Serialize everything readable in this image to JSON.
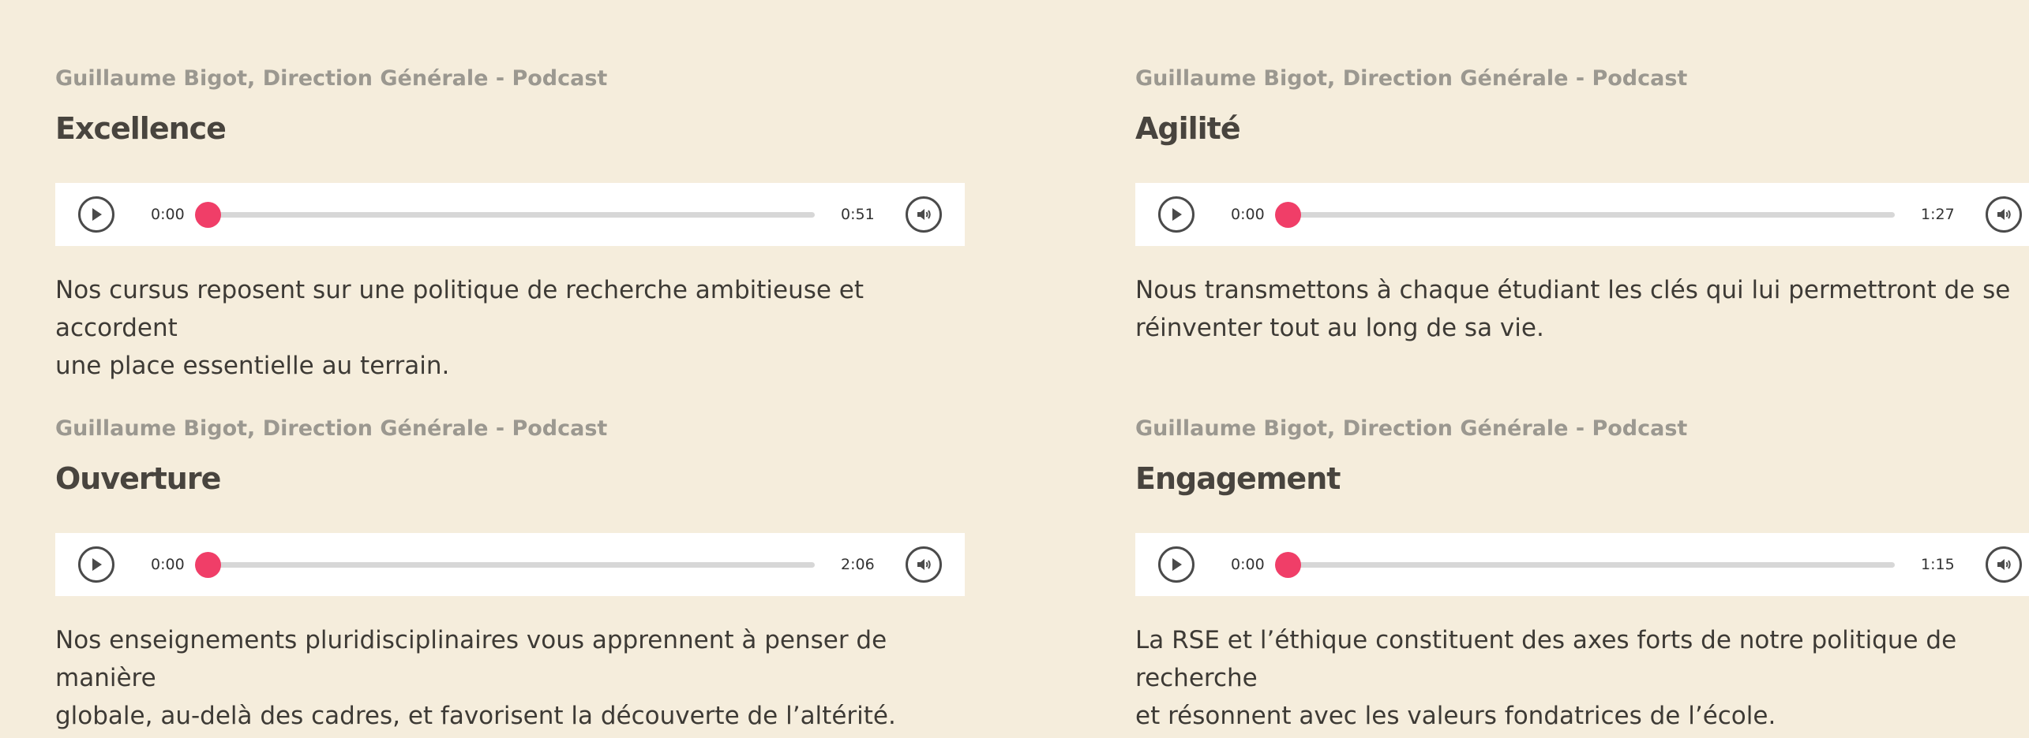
{
  "podcasts": [
    {
      "author": "Guillaume Bigot, Direction Générale - Podcast",
      "title": "Excellence",
      "current_time": "0:00",
      "duration": "0:51",
      "progress": 0,
      "description_line1": "Nos cursus reposent sur une politique de recherche ambitieuse et accordent",
      "description_line2": "une place essentielle au terrain."
    },
    {
      "author": "Guillaume Bigot, Direction Générale - Podcast",
      "title": "Agilité",
      "current_time": "0:00",
      "duration": "1:27",
      "progress": 0,
      "description_line1": "Nous transmettons à chaque étudiant les clés qui lui permettront de se",
      "description_line2": "réinventer tout au long de sa vie."
    },
    {
      "author": "Guillaume Bigot, Direction Générale - Podcast",
      "title": "Ouverture",
      "current_time": "0:00",
      "duration": "2:06",
      "progress": 0,
      "description_line1": "Nos enseignements pluridisciplinaires vous apprennent à penser de manière",
      "description_line2": "globale, au-delà des cadres, et favorisent la découverte de l’altérité."
    },
    {
      "author": "Guillaume Bigot, Direction Générale - Podcast",
      "title": "Engagement",
      "current_time": "0:00",
      "duration": "1:15",
      "progress": 0,
      "description_line1": "La RSE et l’éthique constituent des axes forts de notre politique de recherche",
      "description_line2": "et résonnent avec les valeurs fondatrices de l’école."
    }
  ],
  "icons": {
    "play": "play-icon",
    "volume": "volume-icon"
  },
  "colors": {
    "background": "#f5eddc",
    "thumb": "#f03e68",
    "track": "#d7d7d7",
    "meta": "#9b9890",
    "title": "#48443e"
  }
}
